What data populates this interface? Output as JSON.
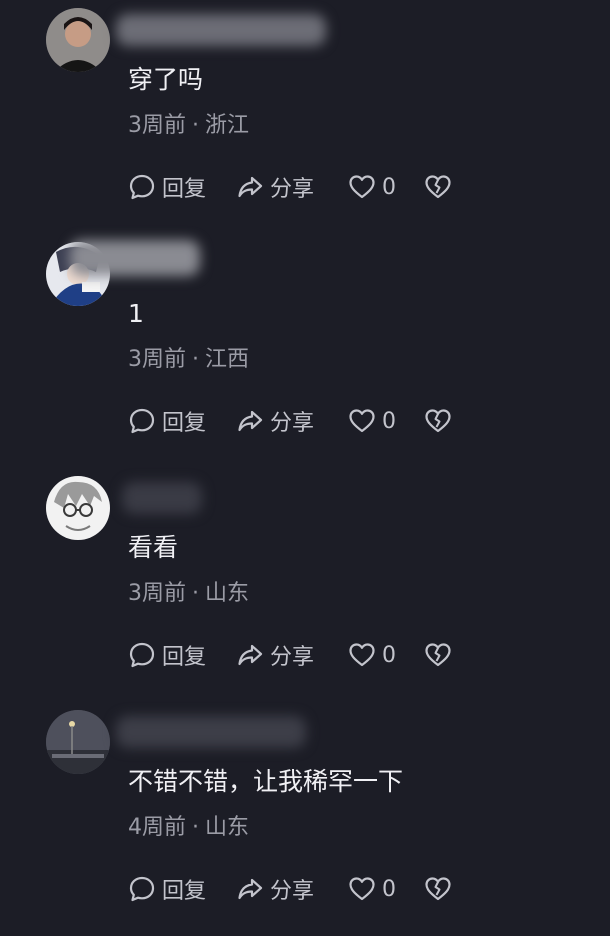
{
  "comments": [
    {
      "text": "穿了吗",
      "time": "3周前",
      "location": "浙江",
      "reply_label": "回复",
      "share_label": "分享",
      "like_count": "0"
    },
    {
      "text": "1",
      "time": "3周前",
      "location": "江西",
      "reply_label": "回复",
      "share_label": "分享",
      "like_count": "0"
    },
    {
      "text": "看看",
      "time": "3周前",
      "location": "山东",
      "reply_label": "回复",
      "share_label": "分享",
      "like_count": "0"
    },
    {
      "text": "不错不错，让我稀罕一下",
      "time": "4周前",
      "location": "山东",
      "reply_label": "回复",
      "share_label": "分享",
      "like_count": "0"
    }
  ],
  "separator": "·",
  "icons": {
    "reply": "chat-bubble-icon",
    "share": "share-arrow-icon",
    "like": "heart-icon",
    "dislike": "broken-heart-icon"
  },
  "colors": {
    "background": "#1c1d26",
    "text": "#f0f0f4",
    "meta": "#9b9ca6",
    "action": "#c3c4cc"
  }
}
